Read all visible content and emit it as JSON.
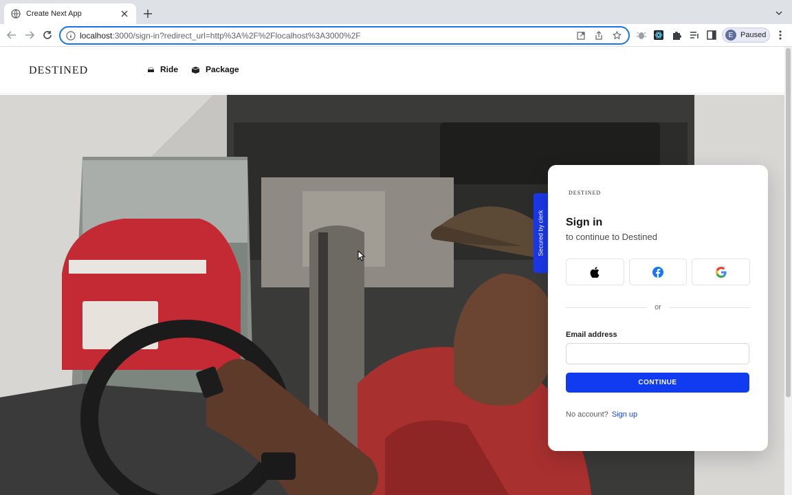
{
  "browser": {
    "tab_title": "Create Next App",
    "url_host": "localhost",
    "url_rest": ":3000/sign-in?redirect_url=http%3A%2F%2Flocalhost%3A3000%2F",
    "profile_initial": "E",
    "profile_status": "Paused"
  },
  "site": {
    "logo": "DESTINED",
    "nav": [
      {
        "label": "Ride",
        "icon": "car-icon"
      },
      {
        "label": "Package",
        "icon": "package-icon"
      }
    ]
  },
  "signin": {
    "badge": "Secured by clerk",
    "card_logo": "DESTINED",
    "title": "Sign in",
    "subtitle": "to continue to Destined",
    "social": [
      {
        "provider": "Apple",
        "icon": "apple-icon"
      },
      {
        "provider": "Facebook",
        "icon": "facebook-icon"
      },
      {
        "provider": "Google",
        "icon": "google-icon"
      }
    ],
    "divider_text": "or",
    "email_label": "Email address",
    "email_value": "",
    "continue_label": "CONTINUE",
    "no_account_text": "No account?",
    "signup_link": "Sign up"
  },
  "colors": {
    "primary": "#103bf0",
    "clerk_badge": "#1a38e8",
    "omnibox_focus": "#1a73e8"
  }
}
